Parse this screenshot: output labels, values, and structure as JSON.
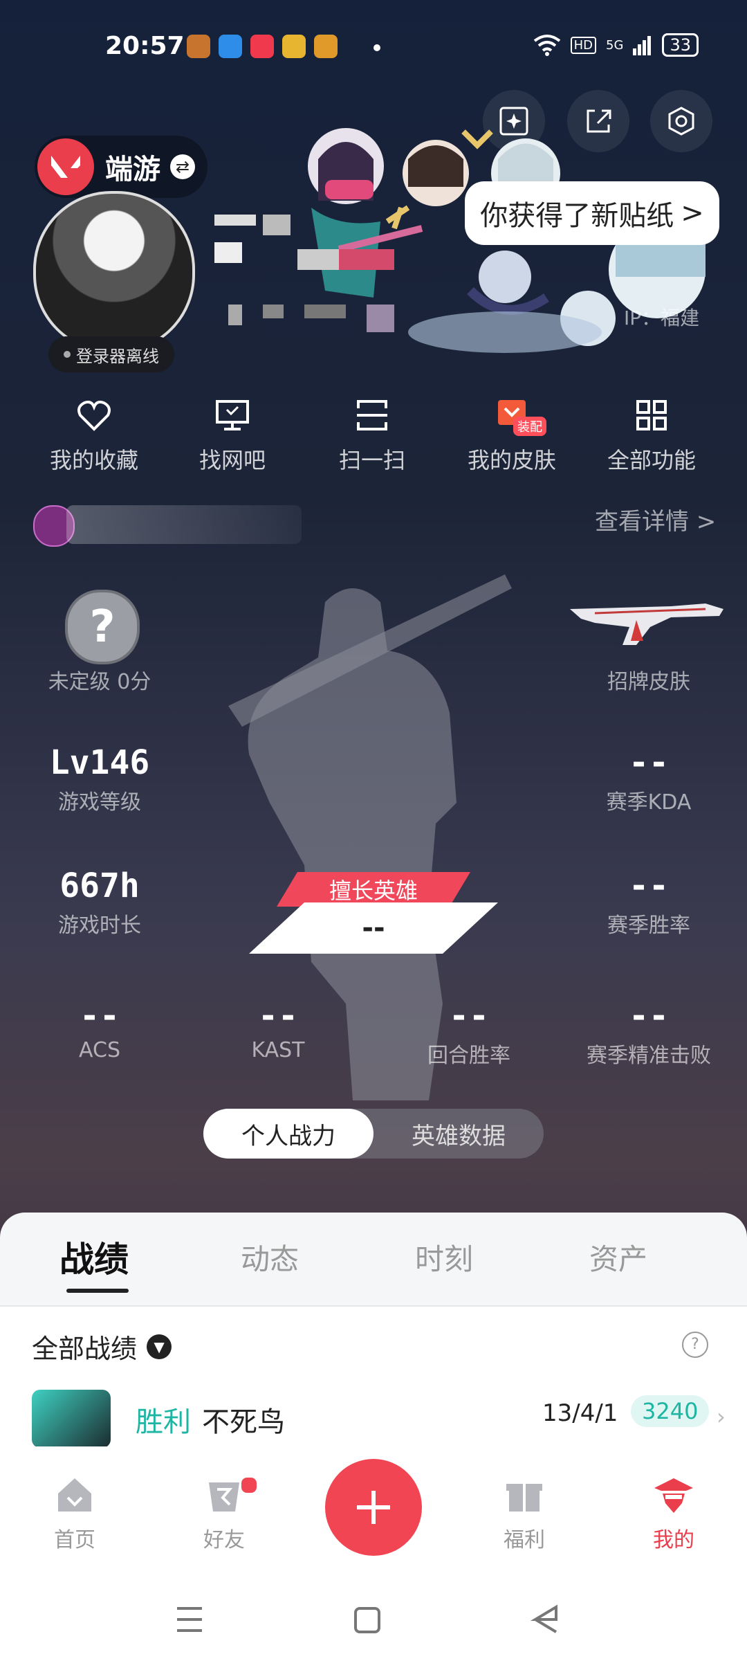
{
  "status_bar": {
    "time": "20:57",
    "network": "5G",
    "hd": "HD",
    "battery": "33"
  },
  "profile": {
    "app_tag": "端游",
    "offline_label": "登录器离线",
    "ip_label": "IP：福建",
    "sticker_tooltip": "你获得了新贴纸",
    "sticker_tooltip_arrow": ">"
  },
  "quick_actions": [
    {
      "label": "我的收藏",
      "icon": "heart-icon"
    },
    {
      "label": "找网吧",
      "icon": "monitor-icon"
    },
    {
      "label": "扫一扫",
      "icon": "scan-icon"
    },
    {
      "label": "我的皮肤",
      "icon": "skin-icon",
      "badge": "装配"
    },
    {
      "label": "全部功能",
      "icon": "grid-icon"
    }
  ],
  "account": {
    "details_link": "查看详情 >"
  },
  "stats": {
    "rank_label": "未定级 0分",
    "rank_icon": "?",
    "skin_label": "招牌皮肤",
    "level_value": "Lv146",
    "level_label": "游戏等级",
    "kda_value": "--",
    "kda_label": "赛季KDA",
    "hours_value": "667h",
    "hours_label": "游戏时长",
    "winrate_value": "--",
    "winrate_label": "赛季胜率",
    "best_hero_tag": "擅长英雄",
    "best_hero_value": "--",
    "acs_value": "--",
    "acs_label": "ACS",
    "kast_value": "--",
    "kast_label": "KAST",
    "round_value": "--",
    "round_label": "回合胜率",
    "precise_value": "--",
    "precise_label": "赛季精准击败"
  },
  "toggle": {
    "personal": "个人战力",
    "hero_data": "英雄数据"
  },
  "tabs": [
    "战绩",
    "动态",
    "时刻",
    "资产"
  ],
  "records": {
    "filter_label": "全部战绩",
    "help": "?",
    "first": {
      "result": "胜利",
      "map": "不死鸟",
      "kda": "13/4/1",
      "score": "3240"
    }
  },
  "bottom_nav": [
    {
      "label": "首页",
      "icon": "home-icon"
    },
    {
      "label": "好友",
      "icon": "friends-icon"
    },
    {
      "label": "+",
      "icon": "plus-icon"
    },
    {
      "label": "福利",
      "icon": "gift-icon"
    },
    {
      "label": "我的",
      "icon": "agent-icon"
    }
  ],
  "colors": {
    "accent": "#ea3e4c",
    "win": "#1fb5a3"
  }
}
